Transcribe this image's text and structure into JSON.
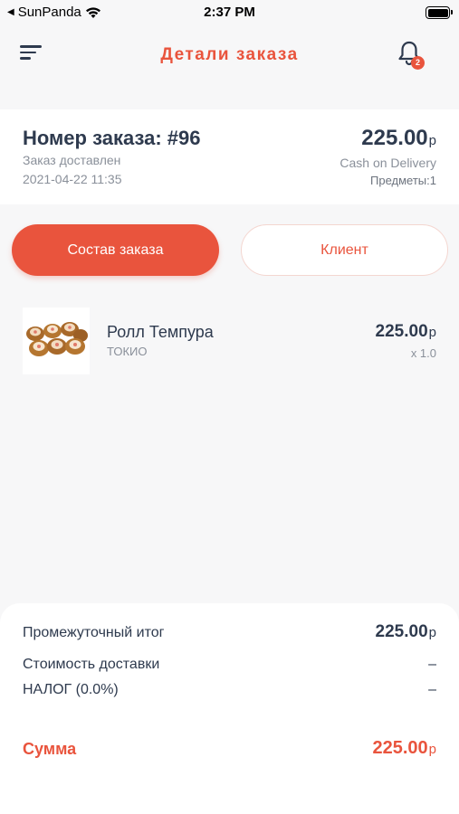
{
  "status_bar": {
    "carrier": "SunPanda",
    "time": "2:37 PM"
  },
  "header": {
    "title": "Детали заказа",
    "notification_count": "2"
  },
  "order": {
    "number": "Номер заказа: #96",
    "status": "Заказ доставлен",
    "date": "2021-04-22 11:35",
    "total": "225.00",
    "currency": "р",
    "payment_method": "Cash on Delivery",
    "items_count": "Предметы:1"
  },
  "tabs": {
    "active": "Состав заказа",
    "inactive": "Клиент"
  },
  "items": [
    {
      "name": "Ролл Темпура",
      "shop": "ТОКИО",
      "price": "225.00",
      "currency": "р",
      "qty": "x 1.0"
    }
  ],
  "summary": {
    "subtotal_label": "Промежуточный итог",
    "subtotal_value": "225.00",
    "delivery_label": "Стоимость доставки",
    "delivery_value": "–",
    "tax_label": "НАЛОГ (0.0%)",
    "tax_value": "–",
    "total_label": "Сумма",
    "total_value": "225.00",
    "currency": "р"
  },
  "colors": {
    "accent": "#e9543d",
    "text": "#2e3a4e",
    "muted": "#8a909a",
    "background": "#f7f7f8"
  }
}
